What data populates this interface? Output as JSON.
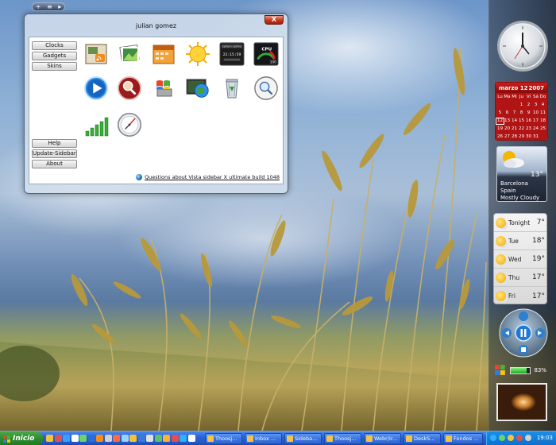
{
  "window": {
    "title": "julian gomez",
    "close_glyph": "X",
    "left_buttons": [
      "Clocks",
      "Gadgets",
      "Skins"
    ],
    "bottom_buttons": [
      "Help",
      "Update-Sidebar",
      "About"
    ],
    "status_link": "Questions about Vista sidebar X ultimate build 1048",
    "gadget_icons": [
      "rss-feeds-icon",
      "photo-slideshow-icon",
      "calendar-gadget-icon",
      "sun-weather-icon",
      "system-uptime-icon",
      "cpu-meter-icon",
      "media-player-icon",
      "search-magnifier-icon",
      "windows-logo-icon",
      "network-globe-icon",
      "recycle-bin-icon",
      "zoom-search-icon",
      "signal-strength-icon",
      "compass-clock-icon"
    ],
    "calendar_icon_text": "calendar",
    "uptime_icon": {
      "line1": "system uptime",
      "line2": "21:15:59"
    },
    "cpu_icon": {
      "label": "CPU",
      "value": "100"
    }
  },
  "sidebar": {
    "top_controls": [
      "+",
      "≡",
      "▸"
    ],
    "calendar": {
      "month": "marzo 12",
      "year": "2007",
      "weekdays": [
        "Lu",
        "Ma",
        "Mi",
        "Ju",
        "Vi",
        "Sá",
        "Do"
      ],
      "days": [
        "",
        "",
        "",
        "1",
        "2",
        "3",
        "4",
        "5",
        "6",
        "7",
        "8",
        "9",
        "10",
        "11",
        "12",
        "13",
        "14",
        "15",
        "16",
        "17",
        "18",
        "19",
        "20",
        "21",
        "22",
        "23",
        "24",
        "25",
        "26",
        "27",
        "28",
        "29",
        "30",
        "31",
        ""
      ],
      "today": "12",
      "nav": "◂ ▸"
    },
    "weather": {
      "temp": "13°",
      "city": "Barcelona",
      "country": "Spain",
      "condition": "Mostly Cloudy"
    },
    "forecast": [
      {
        "day": "Tonight",
        "temp": "7°"
      },
      {
        "day": "Tue",
        "temp": "18°"
      },
      {
        "day": "Wed",
        "temp": "19°"
      },
      {
        "day": "Thu",
        "temp": "17°"
      },
      {
        "day": "Fri",
        "temp": "17°"
      }
    ],
    "battery": {
      "percent_label": "83%",
      "level": 0.83
    }
  },
  "taskbar": {
    "start_label": "Inicio",
    "tasks": [
      "Thoosj...",
      "Inbox ...",
      "Sideba...",
      "Thoosj...",
      "Webr/ir...",
      "DeskS...",
      "Fondos ..."
    ],
    "clock": "19:03"
  },
  "colors": {
    "taskbar_blue": "#2c62d3",
    "start_green": "#2e8a2e",
    "calendar_red": "#b01414",
    "close_red": "#c4361d"
  }
}
